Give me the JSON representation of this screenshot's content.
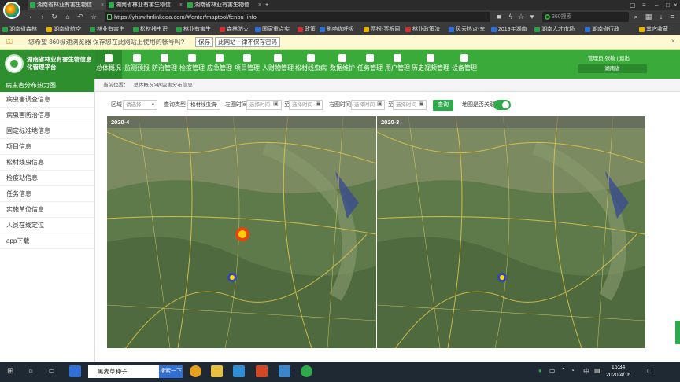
{
  "browser": {
    "tabs": [
      {
        "label": "湖南省林业有害生物信"
      },
      {
        "label": "湖南省林业有害生物信"
      },
      {
        "label": "湖南省林业有害生物信"
      }
    ],
    "new_tab": "+",
    "url": "https://yhsw.hnlinkeda.com/#/enter/maptool/fenbu_info",
    "search_placeholder": "360搜索",
    "bookmarks": [
      "湖南省森林",
      "湖南省航空",
      "林业有害生",
      "松材线虫识",
      "林业有害生",
      "森林防火",
      "国家重点实",
      "政策",
      "影响你呼吸",
      "票根-票根网",
      "林业政策法",
      "风云热点-东",
      "2019年湖南",
      "湖南人才市场",
      "湖南省行政",
      "其它收藏"
    ]
  },
  "password_bar": {
    "message": "您希望 360极速浏览器 保存您在此网站上使用的帐号吗?",
    "save": "保存",
    "never": "此网站一律不保存密码"
  },
  "app": {
    "logo_text": "湖南省林业有害生物信息化管理平台",
    "nav": [
      "总体概况",
      "监测预报",
      "防治管理",
      "检疫管理",
      "应急管理",
      "项目管理",
      "人财物管理",
      "松材线虫病",
      "数据维护",
      "任务管理",
      "用户管理",
      "历史视频管理",
      "设备管理"
    ],
    "user_line": "管理员-张敏 | 退出",
    "region": "湖南省"
  },
  "sidebar": {
    "title": "病虫害分布热力图",
    "items": [
      "病虫害调查信息",
      "病虫害防治信息",
      "固定标准地信息",
      "项目信息",
      "松材线虫信息",
      "检疫站信息",
      "任务信息",
      "实施单位信息",
      "人员在线定位",
      "app下载"
    ]
  },
  "breadcrumb": {
    "prefix": "当前位置：",
    "path": "总体概况>病虫害分布信息"
  },
  "filters": {
    "region_label": "区域",
    "region_placeholder": "请选择",
    "query_type_label": "查询类型",
    "query_type_value": "松材线虫病",
    "left_time_label": "左图时间",
    "right_time_label": "右图时间",
    "start_placeholder": "选择时间",
    "end_placeholder": "选择时间",
    "range_sep": "至",
    "query_btn": "查询",
    "link_label": "地图是否关联",
    "link_on": true
  },
  "maps": {
    "left_label": "2020-4",
    "right_label": "2020-3"
  },
  "taskbar": {
    "search_text": "黑麦草种子",
    "search_btn": "搜索一下",
    "time": "16:34",
    "date": "2020/4/16",
    "lang": "中"
  }
}
